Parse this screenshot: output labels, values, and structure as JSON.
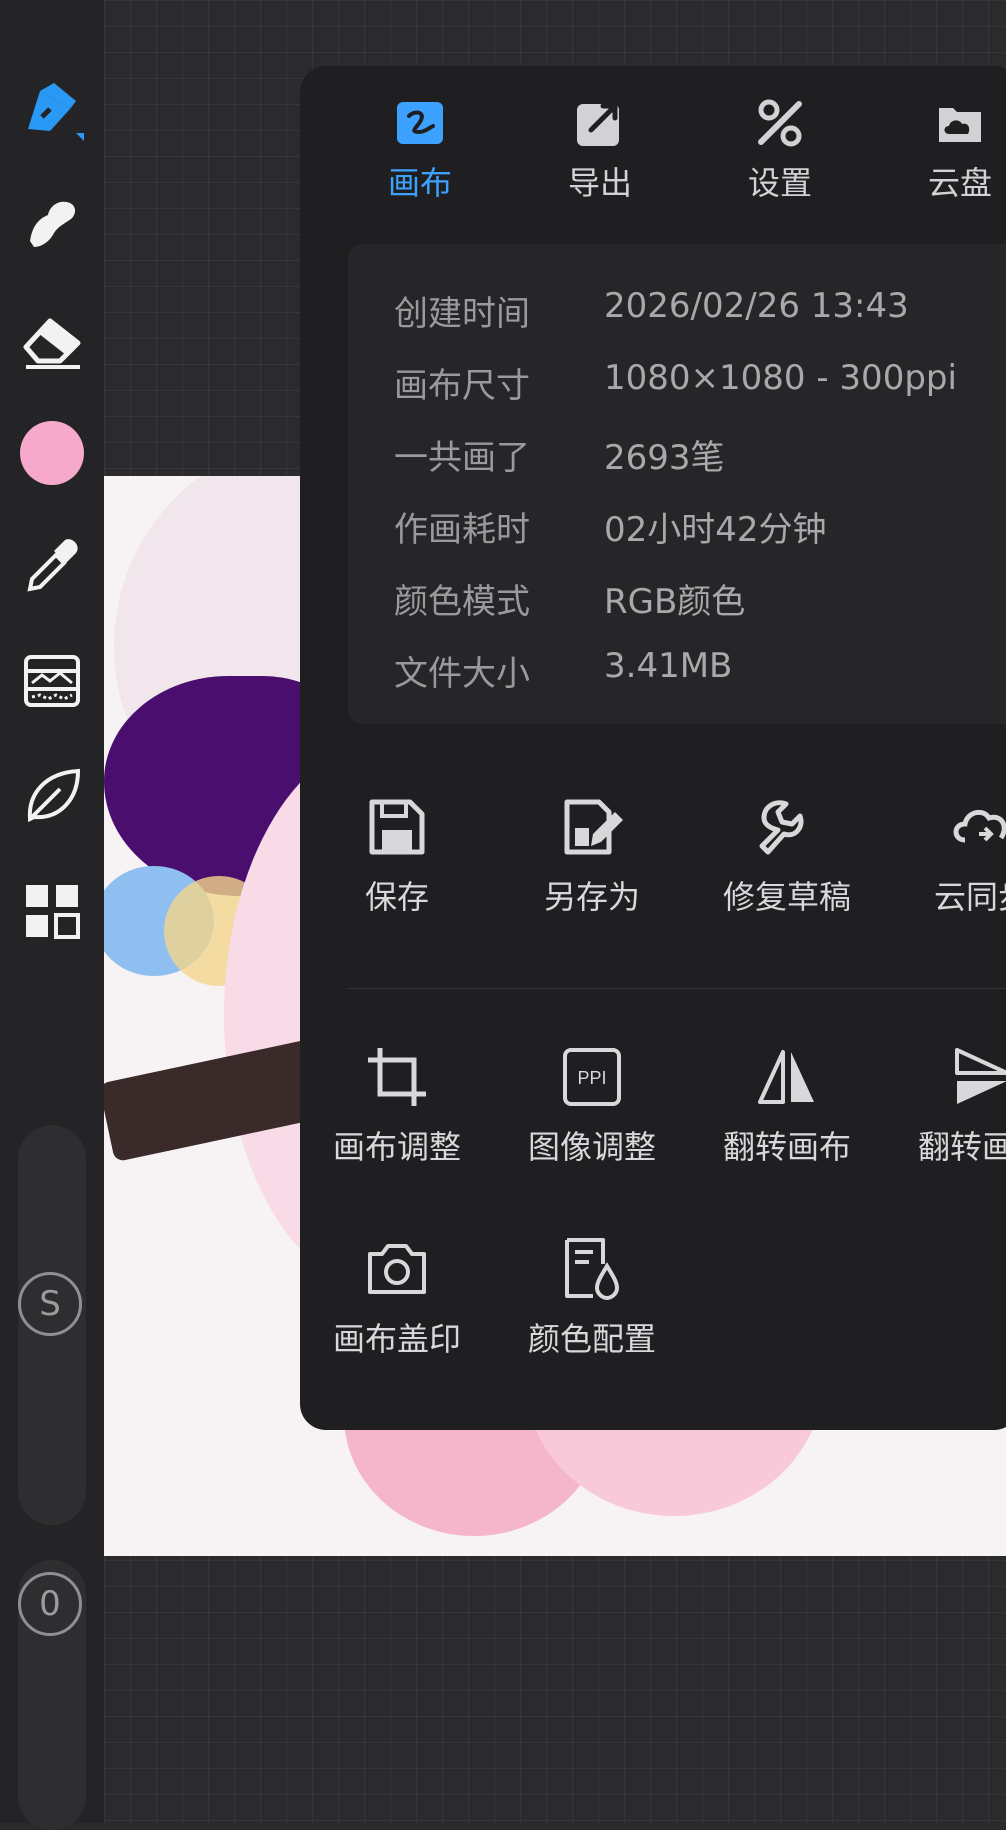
{
  "colors": {
    "accent": "#3da2ff",
    "current_color": "#f7a9cb",
    "panel_bg": "#1f1f21",
    "info_bg": "#262628"
  },
  "toolbar": {
    "tools": [
      {
        "name": "pen-tool",
        "icon": "pen-icon",
        "selected": true
      },
      {
        "name": "smudge-tool",
        "icon": "smudge-icon"
      },
      {
        "name": "eraser-tool",
        "icon": "eraser-icon"
      },
      {
        "name": "color-swatch",
        "icon": "color-circle"
      },
      {
        "name": "eyedropper-tool",
        "icon": "eyedropper-icon"
      },
      {
        "name": "adjust-tool",
        "icon": "image-adjust-icon"
      },
      {
        "name": "leaf-tool",
        "icon": "leaf-icon"
      },
      {
        "name": "layers-tool",
        "icon": "grid-icon"
      }
    ],
    "size_knob_label": "S",
    "opacity_knob_label": "0"
  },
  "tabs": [
    {
      "label": "画布",
      "icon": "canvas-icon",
      "active": true
    },
    {
      "label": "导出",
      "icon": "export-icon",
      "active": false
    },
    {
      "label": "设置",
      "icon": "settings-icon",
      "active": false
    },
    {
      "label": "云盘",
      "icon": "cloud-drive-icon",
      "active": false
    }
  ],
  "info": [
    {
      "key": "创建时间",
      "value": "2026/02/26 13:43"
    },
    {
      "key": "画布尺寸",
      "value": "1080×1080 - 300ppi"
    },
    {
      "key": "一共画了",
      "value": "2693笔"
    },
    {
      "key": "作画耗时",
      "value": "02小时42分钟"
    },
    {
      "key": "颜色模式",
      "value": "RGB颜色"
    },
    {
      "key": "文件大小",
      "value": "3.41MB"
    }
  ],
  "actions_row1": [
    {
      "label": "保存",
      "icon": "save-icon"
    },
    {
      "label": "另存为",
      "icon": "save-as-icon"
    },
    {
      "label": "修复草稿",
      "icon": "repair-icon"
    },
    {
      "label": "云同步",
      "icon": "cloud-sync-icon"
    }
  ],
  "actions_row2": [
    {
      "label": "画布调整",
      "icon": "crop-icon"
    },
    {
      "label": "图像调整",
      "icon": "ppi-icon",
      "icon_text": "PPI"
    },
    {
      "label": "翻转画布",
      "icon": "flip-horizontal-icon"
    },
    {
      "label": "翻转画布",
      "icon": "flip-vertical-icon"
    }
  ],
  "actions_row3": [
    {
      "label": "画布盖印",
      "icon": "camera-icon"
    },
    {
      "label": "颜色配置",
      "icon": "color-profile-icon"
    }
  ]
}
